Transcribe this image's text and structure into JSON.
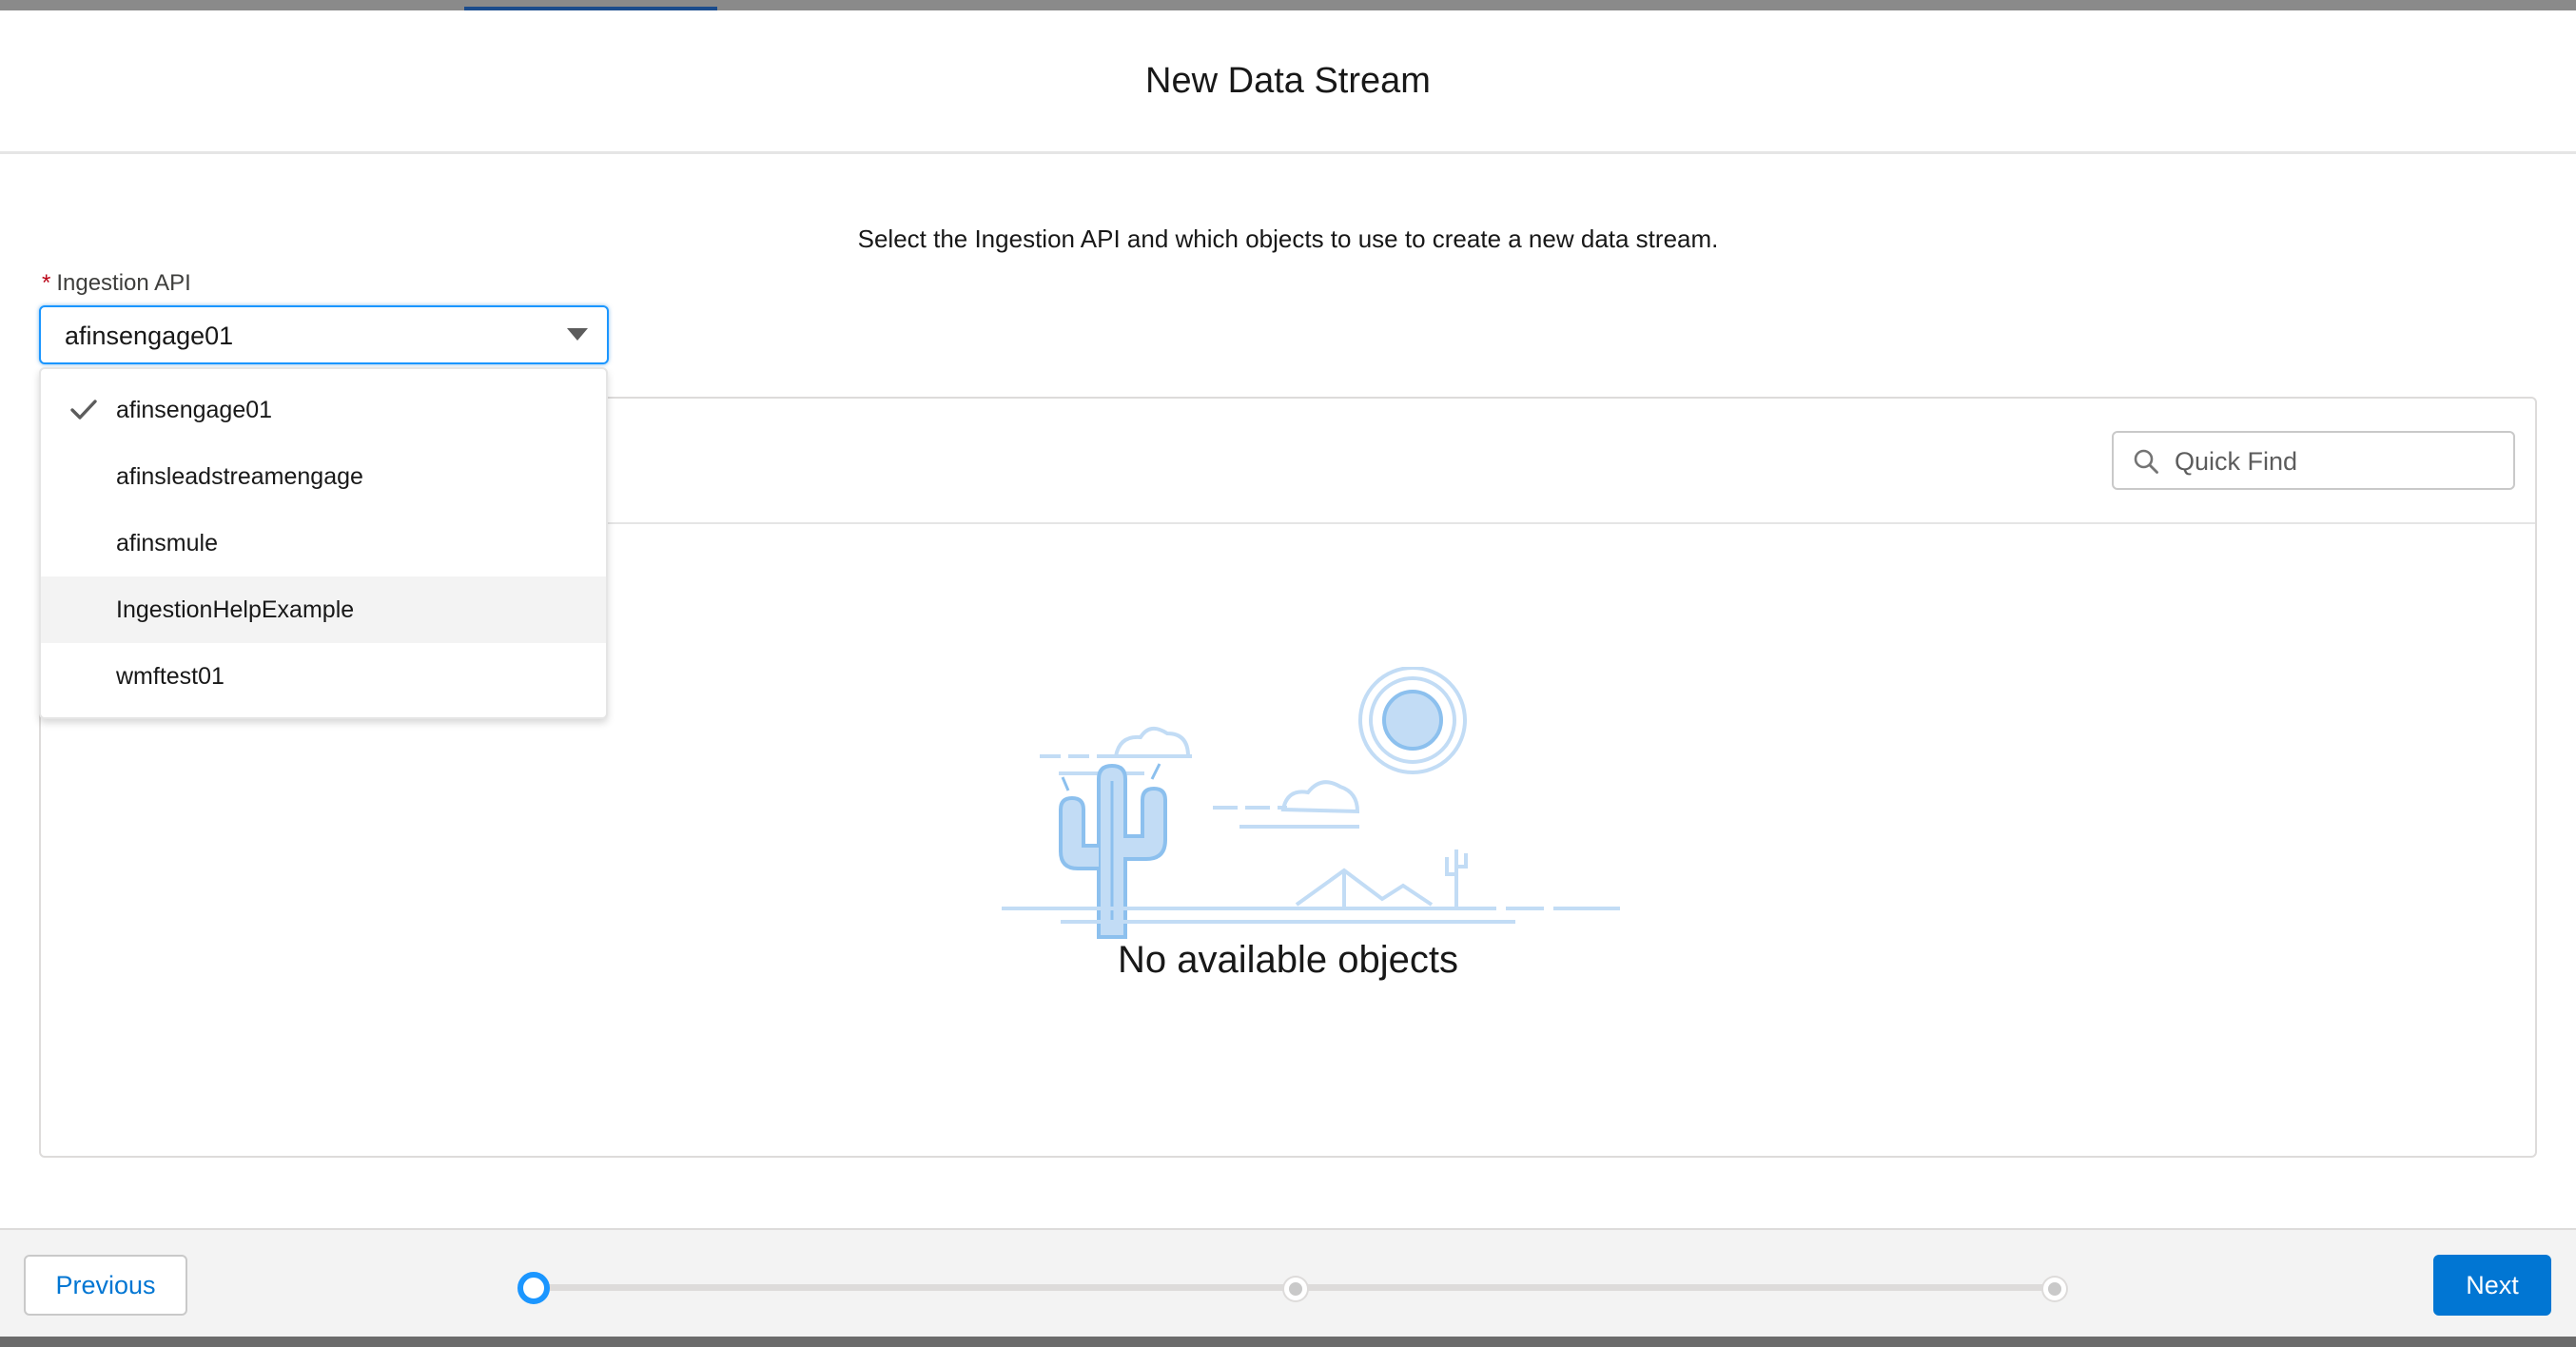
{
  "modal": {
    "title": "New Data Stream",
    "instructions": "Select the Ingestion API and which objects to use to create a new data stream."
  },
  "ingestion_api": {
    "required_marker": "*",
    "label": "Ingestion API",
    "selected_value": "afinsengage01",
    "options": [
      {
        "label": "afinsengage01",
        "selected": true
      },
      {
        "label": "afinsleadstreamengage",
        "selected": false
      },
      {
        "label": "afinsmule",
        "selected": false
      },
      {
        "label": "IngestionHelpExample",
        "selected": false,
        "hovered": true
      },
      {
        "label": "wmftest01",
        "selected": false
      }
    ]
  },
  "objects_panel": {
    "search_placeholder": "Quick Find",
    "empty_message": "No available objects"
  },
  "footer": {
    "previous_label": "Previous",
    "next_label": "Next",
    "progress": {
      "current_step": 1,
      "total_steps": 3
    }
  },
  "colors": {
    "brand": "#0176d3",
    "focus_ring": "#1b96ff",
    "required": "#ba0517",
    "illustration": "#c2dcf5",
    "footer_bg": "#f3f3f3"
  },
  "icons": {
    "dropdown_arrow": "chevron-down-icon",
    "selected_option": "check-icon",
    "search": "search-icon",
    "empty_state": "desert-illustration"
  }
}
